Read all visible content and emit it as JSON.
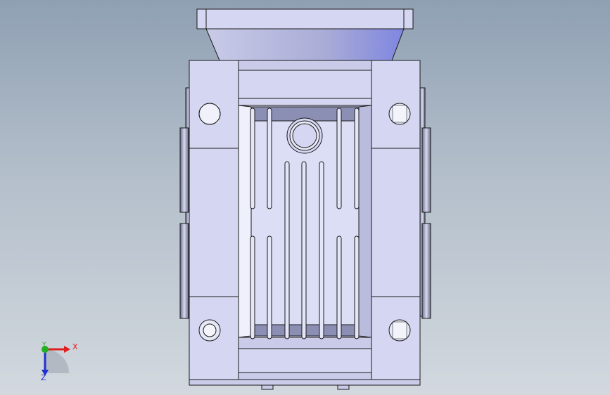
{
  "view": {
    "background_top": "#8fa0b3",
    "background_bottom": "#d2d8de",
    "part_fill": "#d5d7f2",
    "part_shade": "#b7badb",
    "edge_color": "#1a1a1a"
  },
  "triad": {
    "x_label": "X",
    "y_label": "Y",
    "z_label": "Z",
    "x_color": "#e02020",
    "y_color": "#20b020",
    "z_color": "#2030d0"
  }
}
